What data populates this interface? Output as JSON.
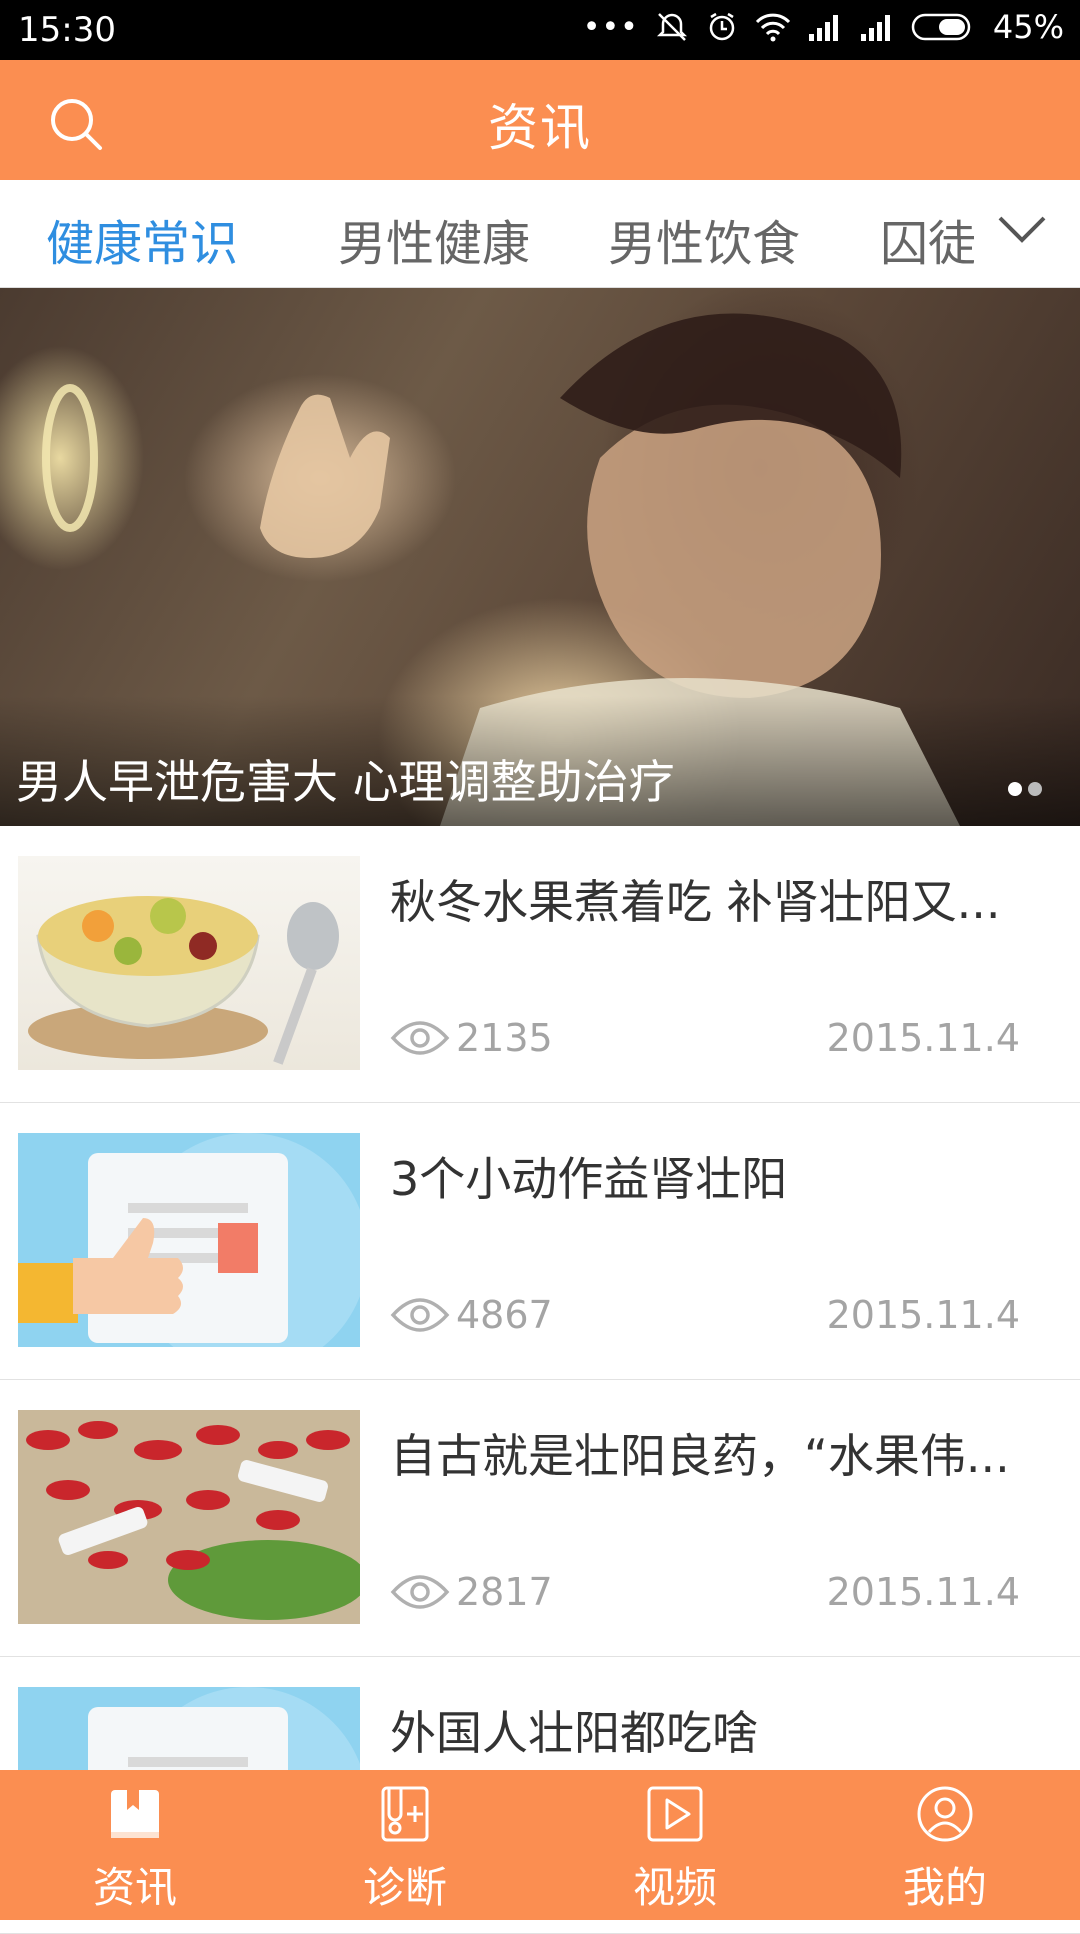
{
  "status_bar": {
    "time": "15:30",
    "battery": "45%"
  },
  "header": {
    "title": "资讯"
  },
  "tabs": [
    {
      "label": "健康常识",
      "active": true
    },
    {
      "label": "男性健康",
      "active": false
    },
    {
      "label": "男性饮食",
      "active": false
    },
    {
      "label": "囚徒",
      "active": false
    }
  ],
  "banner": {
    "caption": "男人早泄危害大 心理调整助治疗",
    "page_count": 2,
    "current_page": 1
  },
  "articles": [
    {
      "title": "秋冬水果煮着吃 补肾壮阳又...",
      "views": "2135",
      "date": "2015.11.4"
    },
    {
      "title": "3个小动作益肾壮阳",
      "views": "4867",
      "date": "2015.11.4"
    },
    {
      "title": "自古就是壮阳良药，“水果伟...",
      "views": "2817",
      "date": "2015.11.4"
    },
    {
      "title": "外国人壮阳都吃啥",
      "views": "",
      "date": ""
    }
  ],
  "bottom_nav": [
    {
      "label": "资讯",
      "icon": "book-icon"
    },
    {
      "label": "诊断",
      "icon": "diagnosis-icon"
    },
    {
      "label": "视频",
      "icon": "play-icon"
    },
    {
      "label": "我的",
      "icon": "user-icon"
    }
  ],
  "colors": {
    "accent": "#fb8e51",
    "tab_active": "#2f8ee0",
    "meta_text": "#a4a4a4"
  }
}
